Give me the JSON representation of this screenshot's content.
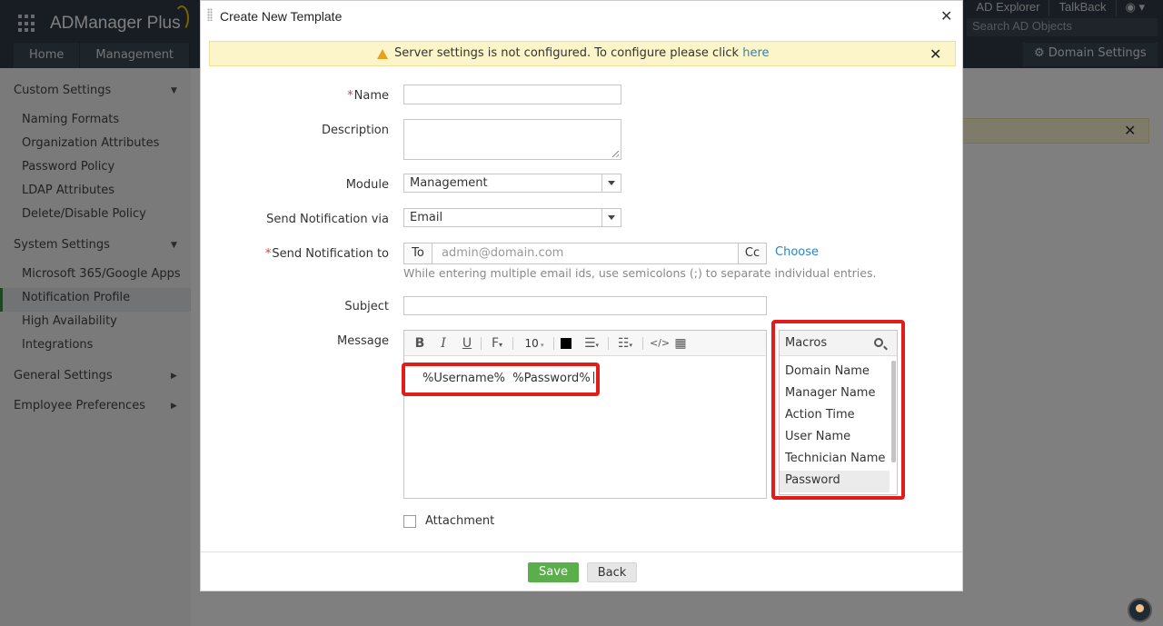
{
  "app": {
    "name": "ADManager Plus",
    "nav_tabs": [
      "Home",
      "Management"
    ],
    "top_links": [
      "AD Explorer",
      "TalkBack"
    ],
    "search_placeholder": "Search AD Objects",
    "domain_settings": "Domain Settings"
  },
  "sidebar": {
    "sections": [
      {
        "label": "Custom Settings",
        "items": [
          "Naming Formats",
          "Organization Attributes",
          "Password Policy",
          "LDAP Attributes",
          "Delete/Disable Policy"
        ]
      },
      {
        "label": "System Settings",
        "items": [
          "Microsoft 365/Google Apps",
          "Notification Profile",
          "High Availability",
          "Integrations"
        ]
      },
      {
        "label": "General Settings",
        "items": []
      },
      {
        "label": "Employee Preferences",
        "items": []
      }
    ],
    "active_item": "Notification Profile"
  },
  "dialog": {
    "title": "Create New Template",
    "alert": {
      "text": "Server settings is not configured. To configure please click ",
      "link": "here"
    },
    "fields": {
      "name_label": "Name",
      "description_label": "Description",
      "module_label": "Module",
      "module_value": "Management",
      "send_via_label": "Send Notification via",
      "send_via_value": "Email",
      "send_to_label": "Send Notification to",
      "to_button": "To",
      "to_placeholder": "admin@domain.com",
      "cc_button": "Cc",
      "choose_link": "Choose",
      "hint": "While entering multiple email ids, use semicolons (;) to separate individual entries.",
      "subject_label": "Subject",
      "message_label": "Message",
      "message_text": "%Username%  %Password%",
      "font_size": "10",
      "attachment_label": "Attachment"
    },
    "macros": {
      "header": "Macros",
      "items": [
        "Domain Name",
        "Manager Name",
        "Action Time",
        "User Name",
        "Technician Name",
        "Password"
      ],
      "selected": "Password"
    },
    "buttons": {
      "save": "Save",
      "back": "Back"
    }
  },
  "colors": {
    "accent": "#2a83c6",
    "save": "#5aaf4a",
    "highlight": "#e21b1b",
    "alert_bg": "#fcf5c9"
  }
}
